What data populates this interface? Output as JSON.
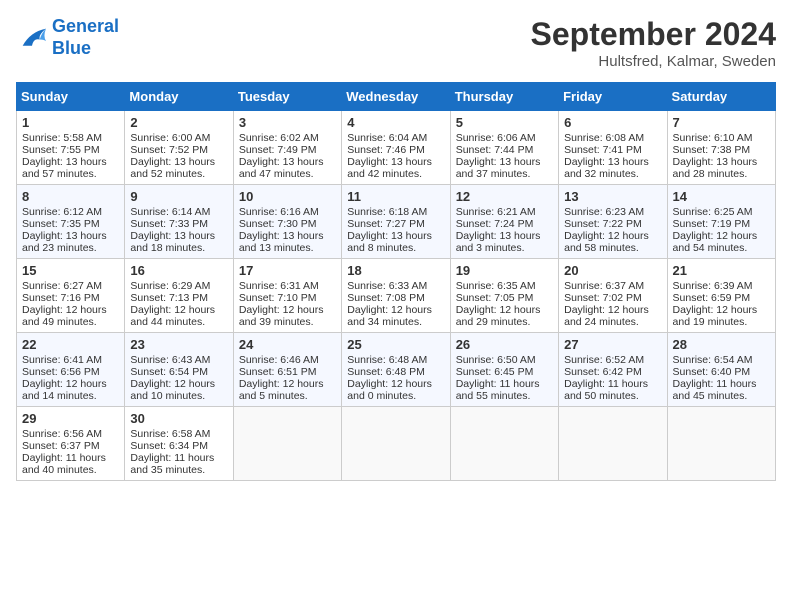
{
  "header": {
    "logo_line1": "General",
    "logo_line2": "Blue",
    "month_year": "September 2024",
    "location": "Hultsfred, Kalmar, Sweden"
  },
  "days_of_week": [
    "Sunday",
    "Monday",
    "Tuesday",
    "Wednesday",
    "Thursday",
    "Friday",
    "Saturday"
  ],
  "weeks": [
    [
      {
        "day": "1",
        "sunrise": "Sunrise: 5:58 AM",
        "sunset": "Sunset: 7:55 PM",
        "daylight": "Daylight: 13 hours and 57 minutes."
      },
      {
        "day": "2",
        "sunrise": "Sunrise: 6:00 AM",
        "sunset": "Sunset: 7:52 PM",
        "daylight": "Daylight: 13 hours and 52 minutes."
      },
      {
        "day": "3",
        "sunrise": "Sunrise: 6:02 AM",
        "sunset": "Sunset: 7:49 PM",
        "daylight": "Daylight: 13 hours and 47 minutes."
      },
      {
        "day": "4",
        "sunrise": "Sunrise: 6:04 AM",
        "sunset": "Sunset: 7:46 PM",
        "daylight": "Daylight: 13 hours and 42 minutes."
      },
      {
        "day": "5",
        "sunrise": "Sunrise: 6:06 AM",
        "sunset": "Sunset: 7:44 PM",
        "daylight": "Daylight: 13 hours and 37 minutes."
      },
      {
        "day": "6",
        "sunrise": "Sunrise: 6:08 AM",
        "sunset": "Sunset: 7:41 PM",
        "daylight": "Daylight: 13 hours and 32 minutes."
      },
      {
        "day": "7",
        "sunrise": "Sunrise: 6:10 AM",
        "sunset": "Sunset: 7:38 PM",
        "daylight": "Daylight: 13 hours and 28 minutes."
      }
    ],
    [
      {
        "day": "8",
        "sunrise": "Sunrise: 6:12 AM",
        "sunset": "Sunset: 7:35 PM",
        "daylight": "Daylight: 13 hours and 23 minutes."
      },
      {
        "day": "9",
        "sunrise": "Sunrise: 6:14 AM",
        "sunset": "Sunset: 7:33 PM",
        "daylight": "Daylight: 13 hours and 18 minutes."
      },
      {
        "day": "10",
        "sunrise": "Sunrise: 6:16 AM",
        "sunset": "Sunset: 7:30 PM",
        "daylight": "Daylight: 13 hours and 13 minutes."
      },
      {
        "day": "11",
        "sunrise": "Sunrise: 6:18 AM",
        "sunset": "Sunset: 7:27 PM",
        "daylight": "Daylight: 13 hours and 8 minutes."
      },
      {
        "day": "12",
        "sunrise": "Sunrise: 6:21 AM",
        "sunset": "Sunset: 7:24 PM",
        "daylight": "Daylight: 13 hours and 3 minutes."
      },
      {
        "day": "13",
        "sunrise": "Sunrise: 6:23 AM",
        "sunset": "Sunset: 7:22 PM",
        "daylight": "Daylight: 12 hours and 58 minutes."
      },
      {
        "day": "14",
        "sunrise": "Sunrise: 6:25 AM",
        "sunset": "Sunset: 7:19 PM",
        "daylight": "Daylight: 12 hours and 54 minutes."
      }
    ],
    [
      {
        "day": "15",
        "sunrise": "Sunrise: 6:27 AM",
        "sunset": "Sunset: 7:16 PM",
        "daylight": "Daylight: 12 hours and 49 minutes."
      },
      {
        "day": "16",
        "sunrise": "Sunrise: 6:29 AM",
        "sunset": "Sunset: 7:13 PM",
        "daylight": "Daylight: 12 hours and 44 minutes."
      },
      {
        "day": "17",
        "sunrise": "Sunrise: 6:31 AM",
        "sunset": "Sunset: 7:10 PM",
        "daylight": "Daylight: 12 hours and 39 minutes."
      },
      {
        "day": "18",
        "sunrise": "Sunrise: 6:33 AM",
        "sunset": "Sunset: 7:08 PM",
        "daylight": "Daylight: 12 hours and 34 minutes."
      },
      {
        "day": "19",
        "sunrise": "Sunrise: 6:35 AM",
        "sunset": "Sunset: 7:05 PM",
        "daylight": "Daylight: 12 hours and 29 minutes."
      },
      {
        "day": "20",
        "sunrise": "Sunrise: 6:37 AM",
        "sunset": "Sunset: 7:02 PM",
        "daylight": "Daylight: 12 hours and 24 minutes."
      },
      {
        "day": "21",
        "sunrise": "Sunrise: 6:39 AM",
        "sunset": "Sunset: 6:59 PM",
        "daylight": "Daylight: 12 hours and 19 minutes."
      }
    ],
    [
      {
        "day": "22",
        "sunrise": "Sunrise: 6:41 AM",
        "sunset": "Sunset: 6:56 PM",
        "daylight": "Daylight: 12 hours and 14 minutes."
      },
      {
        "day": "23",
        "sunrise": "Sunrise: 6:43 AM",
        "sunset": "Sunset: 6:54 PM",
        "daylight": "Daylight: 12 hours and 10 minutes."
      },
      {
        "day": "24",
        "sunrise": "Sunrise: 6:46 AM",
        "sunset": "Sunset: 6:51 PM",
        "daylight": "Daylight: 12 hours and 5 minutes."
      },
      {
        "day": "25",
        "sunrise": "Sunrise: 6:48 AM",
        "sunset": "Sunset: 6:48 PM",
        "daylight": "Daylight: 12 hours and 0 minutes."
      },
      {
        "day": "26",
        "sunrise": "Sunrise: 6:50 AM",
        "sunset": "Sunset: 6:45 PM",
        "daylight": "Daylight: 11 hours and 55 minutes."
      },
      {
        "day": "27",
        "sunrise": "Sunrise: 6:52 AM",
        "sunset": "Sunset: 6:42 PM",
        "daylight": "Daylight: 11 hours and 50 minutes."
      },
      {
        "day": "28",
        "sunrise": "Sunrise: 6:54 AM",
        "sunset": "Sunset: 6:40 PM",
        "daylight": "Daylight: 11 hours and 45 minutes."
      }
    ],
    [
      {
        "day": "29",
        "sunrise": "Sunrise: 6:56 AM",
        "sunset": "Sunset: 6:37 PM",
        "daylight": "Daylight: 11 hours and 40 minutes."
      },
      {
        "day": "30",
        "sunrise": "Sunrise: 6:58 AM",
        "sunset": "Sunset: 6:34 PM",
        "daylight": "Daylight: 11 hours and 35 minutes."
      },
      null,
      null,
      null,
      null,
      null
    ]
  ]
}
